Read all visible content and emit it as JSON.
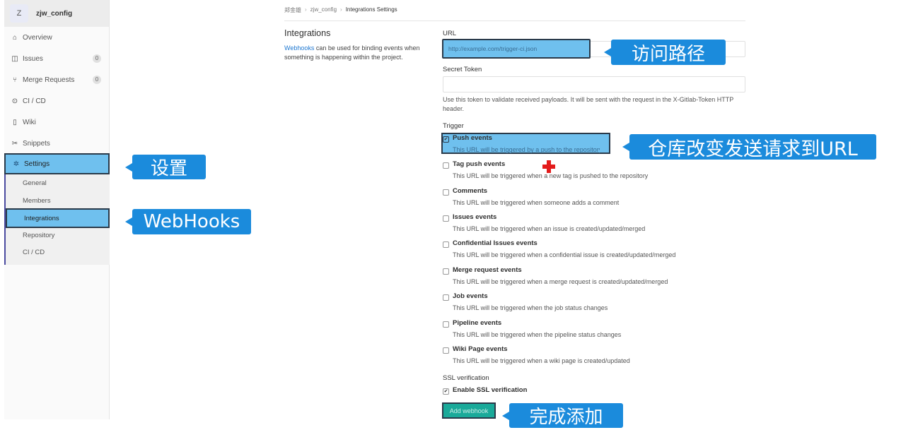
{
  "sidebar": {
    "project_avatar": "Z",
    "project_name": "zjw_config",
    "items": [
      {
        "label": "Overview",
        "icon": "home-icon"
      },
      {
        "label": "Issues",
        "icon": "issues-icon",
        "count": "0"
      },
      {
        "label": "Merge Requests",
        "icon": "merge-request-icon",
        "count": "0"
      },
      {
        "label": "CI / CD",
        "icon": "pipeline-icon"
      },
      {
        "label": "Wiki",
        "icon": "book-icon"
      },
      {
        "label": "Snippets",
        "icon": "scissors-icon"
      },
      {
        "label": "Settings",
        "icon": "gear-icon"
      }
    ],
    "settings_sub": [
      "General",
      "Members",
      "Integrations",
      "Repository",
      "CI / CD"
    ]
  },
  "breadcrumb": [
    "郑金雄",
    "zjw_config",
    "Integrations Settings"
  ],
  "integrations": {
    "title": "Integrations",
    "desc_link": "Webhooks",
    "desc_rest": " can be used for binding events when something is happening within the project."
  },
  "form": {
    "url_label": "URL",
    "url_placeholder": "http://example.com/trigger-ci.json",
    "token_label": "Secret Token",
    "token_help": "Use this token to validate received payloads. It will be sent with the request in the X-Gitlab-Token HTTP header.",
    "trigger_label": "Trigger",
    "triggers": [
      {
        "title": "Push events",
        "desc": "This URL will be triggered by a push to the repository",
        "checked": "✔"
      },
      {
        "title": "Tag push events",
        "desc": "This URL will be triggered when a new tag is pushed to the repository",
        "checked": ""
      },
      {
        "title": "Comments",
        "desc": "This URL will be triggered when someone adds a comment",
        "checked": ""
      },
      {
        "title": "Issues events",
        "desc": "This URL will be triggered when an issue is created/updated/merged",
        "checked": ""
      },
      {
        "title": "Confidential Issues events",
        "desc": "This URL will be triggered when a confidential issue is created/updated/merged",
        "checked": ""
      },
      {
        "title": "Merge request events",
        "desc": "This URL will be triggered when a merge request is created/updated/merged",
        "checked": ""
      },
      {
        "title": "Job events",
        "desc": "This URL will be triggered when the job status changes",
        "checked": ""
      },
      {
        "title": "Pipeline events",
        "desc": "This URL will be triggered when the pipeline status changes",
        "checked": ""
      },
      {
        "title": "Wiki Page events",
        "desc": "This URL will be triggered when a wiki page is created/updated",
        "checked": ""
      }
    ],
    "ssl_label": "SSL verification",
    "ssl_option": "Enable SSL verification",
    "ssl_checked": "✔",
    "submit_label": "Add webhook"
  },
  "callouts": {
    "settings": "设置",
    "webhooks": "WebHooks",
    "url_path": "访问路径",
    "push": "仓库改变发送请求到URL",
    "add": "完成添加"
  },
  "colors": {
    "highlight": "#6fc0ee",
    "callout": "#1b8bdc",
    "button": "#1aaa9a",
    "link": "#1f78d1"
  }
}
